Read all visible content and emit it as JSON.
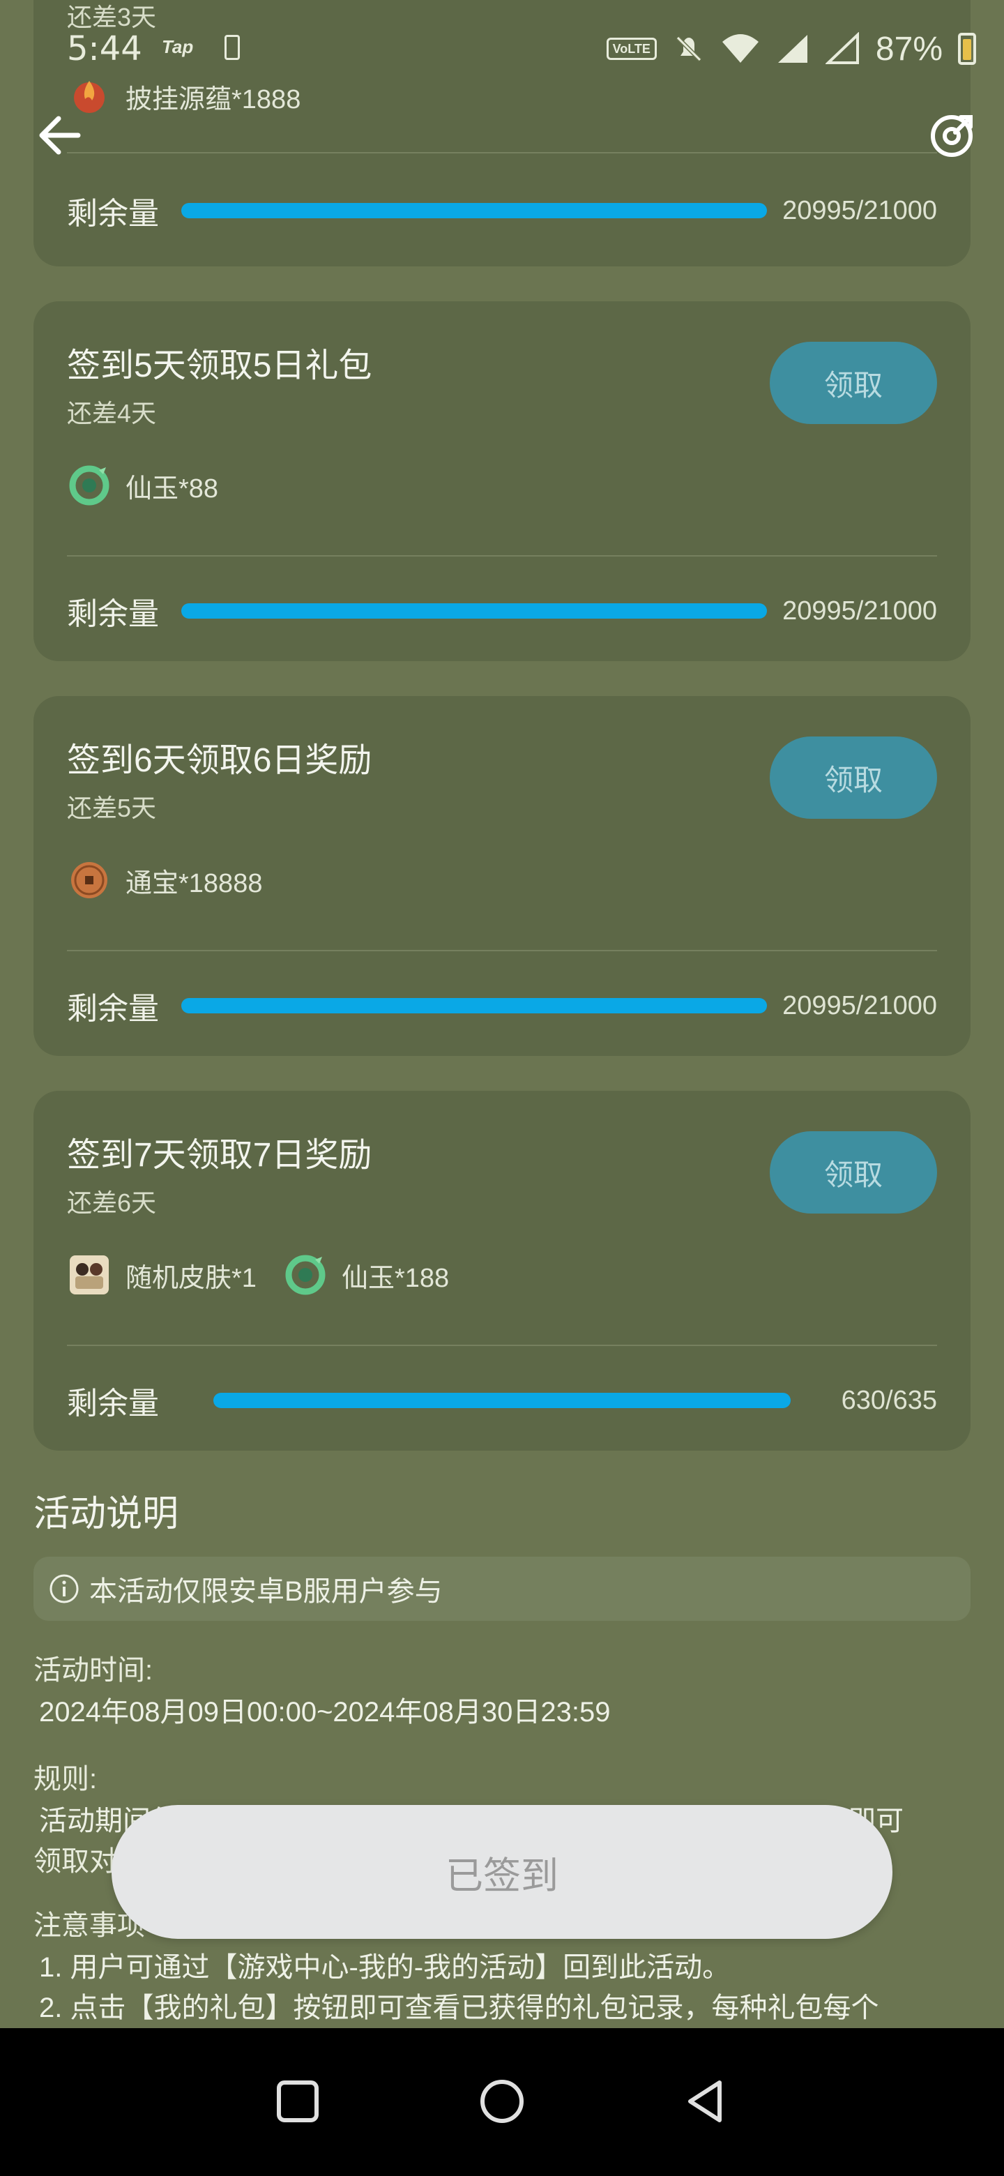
{
  "status_bar": {
    "time": "5:44",
    "tap_label": "Tap",
    "volte_label": "VoLTE",
    "battery_pct": "87%"
  },
  "cards": [
    {
      "title": "",
      "subtitle": "还差3天",
      "rewards": [
        {
          "icon": "flame-gem-icon",
          "label": "披挂源蕴*1888"
        }
      ],
      "remain_label": "剩余量",
      "remain_value": "20995/21000",
      "remain_fraction": 0.9998
    },
    {
      "title": "签到5天领取5日礼包",
      "subtitle": "还差4天",
      "claim_label": "领取",
      "rewards": [
        {
          "icon": "jade-dragon-icon",
          "label": "仙玉*88"
        }
      ],
      "remain_label": "剩余量",
      "remain_value": "20995/21000",
      "remain_fraction": 0.9998
    },
    {
      "title": "签到6天领取6日奖励",
      "subtitle": "还差5天",
      "claim_label": "领取",
      "rewards": [
        {
          "icon": "copper-coin-icon",
          "label": "通宝*18888"
        }
      ],
      "remain_label": "剩余量",
      "remain_value": "20995/21000",
      "remain_fraction": 0.9998
    },
    {
      "title": "签到7天领取7日奖励",
      "subtitle": "还差6天",
      "claim_label": "领取",
      "rewards": [
        {
          "icon": "random-skin-icon",
          "label": "随机皮肤*1"
        },
        {
          "icon": "jade-dragon-icon",
          "label": "仙玉*188"
        }
      ],
      "remain_label": "剩余量",
      "remain_value": "630/635",
      "remain_fraction": 0.992
    }
  ],
  "activity": {
    "title": "活动说明",
    "notice": "本活动仅限安卓B服用户参与",
    "time_label": "活动时间:",
    "time_value": "2024年08月09日00:00~2024年08月30日23:59",
    "rules_label": "规则:",
    "rules_line1": "活动期间每日在页面点击立即签到，累计签到天数达到对应天数，即可",
    "rules_line2": "领取对",
    "notes_label": "注意事项",
    "note1": "1. 用户可通过【游戏中心-我的-我的活动】回到此活动。",
    "note2": "2. 点击【我的礼包】按钮即可查看已获得的礼包记录，每种礼包每个"
  },
  "signed_button": "已签到",
  "colors": {
    "background": "#6b7551",
    "card": "#5d6847",
    "progress": "#0aa8e6",
    "claim_button": "#3e8fa0"
  }
}
